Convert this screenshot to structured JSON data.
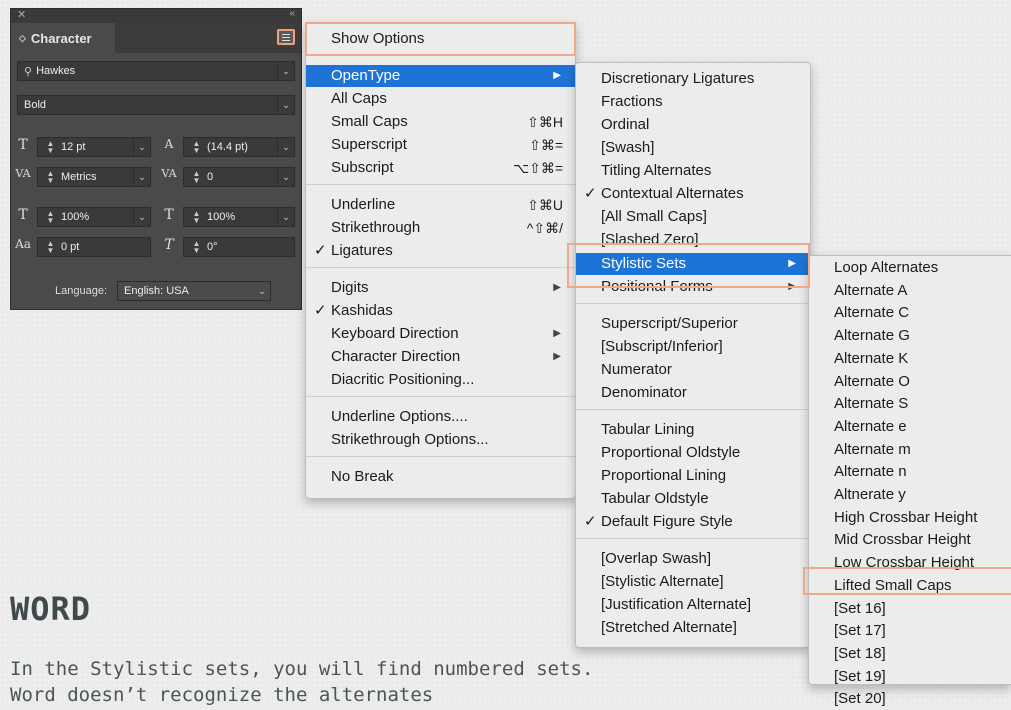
{
  "panel": {
    "title": "Character",
    "font_family": "Hawkes",
    "font_style": "Bold",
    "size": "12 pt",
    "leading": "(14.4 pt)",
    "kerning": "Metrics",
    "tracking": "0",
    "vscale": "100%",
    "hscale": "100%",
    "baseline": "0 pt",
    "skew": "0°",
    "language_label": "Language:",
    "language": "English: USA"
  },
  "menu1": {
    "items": [
      {
        "label": "Show Options",
        "shortcut": "",
        "check": "",
        "sub": false
      },
      {
        "label": "OpenType",
        "shortcut": "",
        "check": "",
        "sub": true,
        "hl": true
      },
      {
        "label": "All Caps",
        "shortcut": "",
        "check": "",
        "sub": false
      },
      {
        "label": "Small Caps",
        "shortcut": "⇧⌘H",
        "check": "",
        "sub": false
      },
      {
        "label": "Superscript",
        "shortcut": "⇧⌘=",
        "check": "",
        "sub": false
      },
      {
        "label": "Subscript",
        "shortcut": "⌥⇧⌘=",
        "check": "",
        "sub": false
      },
      {
        "label": "Underline",
        "shortcut": "⇧⌘U",
        "check": "",
        "sub": false
      },
      {
        "label": "Strikethrough",
        "shortcut": "^⇧⌘/",
        "check": "",
        "sub": false
      },
      {
        "label": "Ligatures",
        "shortcut": "",
        "check": "✓",
        "sub": false
      },
      {
        "label": "Digits",
        "shortcut": "",
        "check": "",
        "sub": true
      },
      {
        "label": "Kashidas",
        "shortcut": "",
        "check": "✓",
        "sub": false
      },
      {
        "label": "Keyboard Direction",
        "shortcut": "",
        "check": "",
        "sub": true
      },
      {
        "label": "Character Direction",
        "shortcut": "",
        "check": "",
        "sub": true
      },
      {
        "label": "Diacritic Positioning...",
        "shortcut": "",
        "check": "",
        "sub": false
      },
      {
        "label": "Underline Options....",
        "shortcut": "",
        "check": "",
        "sub": false
      },
      {
        "label": "Strikethrough Options...",
        "shortcut": "",
        "check": "",
        "sub": false
      },
      {
        "label": "No Break",
        "shortcut": "",
        "check": "",
        "sub": false
      }
    ]
  },
  "menu2": {
    "items": [
      {
        "label": "Discretionary Ligatures",
        "check": ""
      },
      {
        "label": "Fractions",
        "check": ""
      },
      {
        "label": "Ordinal",
        "check": ""
      },
      {
        "label": "[Swash]",
        "check": ""
      },
      {
        "label": "Titling Alternates",
        "check": ""
      },
      {
        "label": "Contextual Alternates",
        "check": "✓"
      },
      {
        "label": "[All Small Caps]",
        "check": ""
      },
      {
        "label": "[Slashed Zero]",
        "check": ""
      },
      {
        "label": "Stylistic Sets",
        "check": "",
        "sub": true,
        "hl": true
      },
      {
        "label": "Positional Forms",
        "check": "",
        "sub": true
      },
      {
        "label": "Superscript/Superior",
        "check": ""
      },
      {
        "label": "[Subscript/Inferior]",
        "check": ""
      },
      {
        "label": "Numerator",
        "check": ""
      },
      {
        "label": "Denominator",
        "check": ""
      },
      {
        "label": "Tabular Lining",
        "check": ""
      },
      {
        "label": "Proportional Oldstyle",
        "check": ""
      },
      {
        "label": "Proportional Lining",
        "check": ""
      },
      {
        "label": "Tabular Oldstyle",
        "check": ""
      },
      {
        "label": "Default Figure Style",
        "check": "✓"
      },
      {
        "label": "[Overlap Swash]",
        "check": ""
      },
      {
        "label": "[Stylistic Alternate]",
        "check": ""
      },
      {
        "label": "[Justification Alternate]",
        "check": ""
      },
      {
        "label": "[Stretched Alternate]",
        "check": ""
      }
    ]
  },
  "menu3": {
    "items": [
      "Loop Alternates",
      "Alternate A",
      "Alternate C",
      "Alternate G",
      "Alternate K",
      "Alternate O",
      "Alternate S",
      "Alternate e",
      "Alternate m",
      "Alternate n",
      "Altnerate y",
      "High Crossbar Height",
      "Mid Crossbar Height",
      "Low Crossbar Height",
      "Lifted Small Caps",
      "[Set 16]",
      "[Set 17]",
      "[Set 18]",
      "[Set 19]",
      "[Set 20]"
    ]
  },
  "article": {
    "heading": "WORD",
    "text": "In the Stylistic sets, you will find numbered sets. Word doesn’t recognize the alternates"
  },
  "colors": {
    "highlight": "#1e74d6",
    "callout": "#f1a888",
    "panel": "#4a4a4a"
  }
}
